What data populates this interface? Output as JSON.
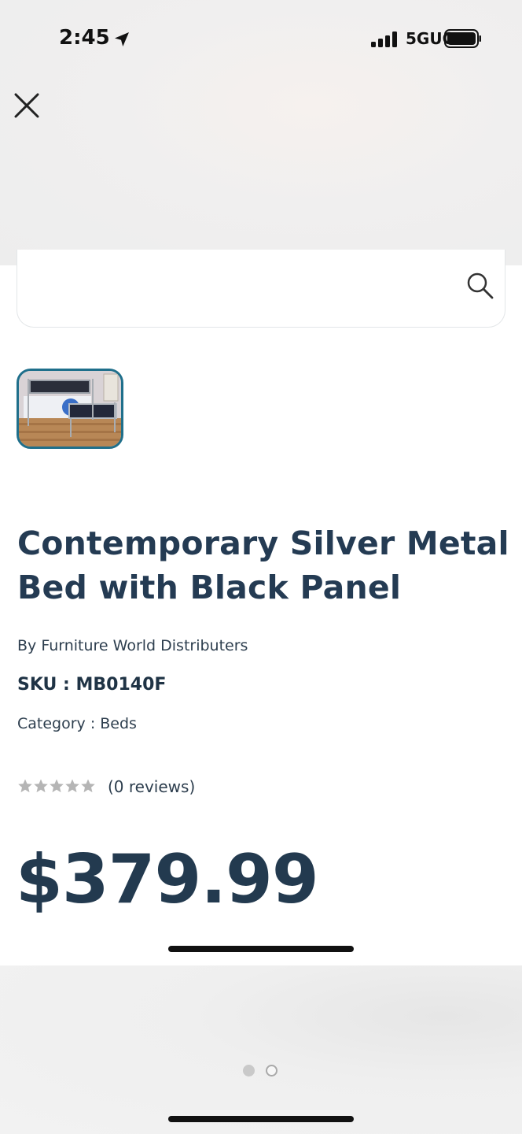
{
  "status_bar": {
    "time": "2:45",
    "network": "5GUC",
    "icons": [
      "location-arrow-icon",
      "signal-bars-icon",
      "battery-icon"
    ]
  },
  "overlay": {
    "close_icon": "close-icon"
  },
  "search": {
    "icon": "search-icon"
  },
  "product": {
    "thumbnail_alt": "product-thumbnail",
    "title": "Contemporary Silver Metal Bed with Black Panel",
    "brand": "By Furniture World Distributers",
    "sku": "SKU : MB0140F",
    "category": "Category : Beds",
    "rating": 0,
    "rating_max": 5,
    "reviews": "(0 reviews)",
    "price": "$379.99"
  },
  "carousel": {
    "active_index": 0,
    "count": 2
  },
  "colors": {
    "title": "#243b53",
    "thumb_border": "#1f6f8b",
    "star_empty": "#b5b5b5"
  }
}
